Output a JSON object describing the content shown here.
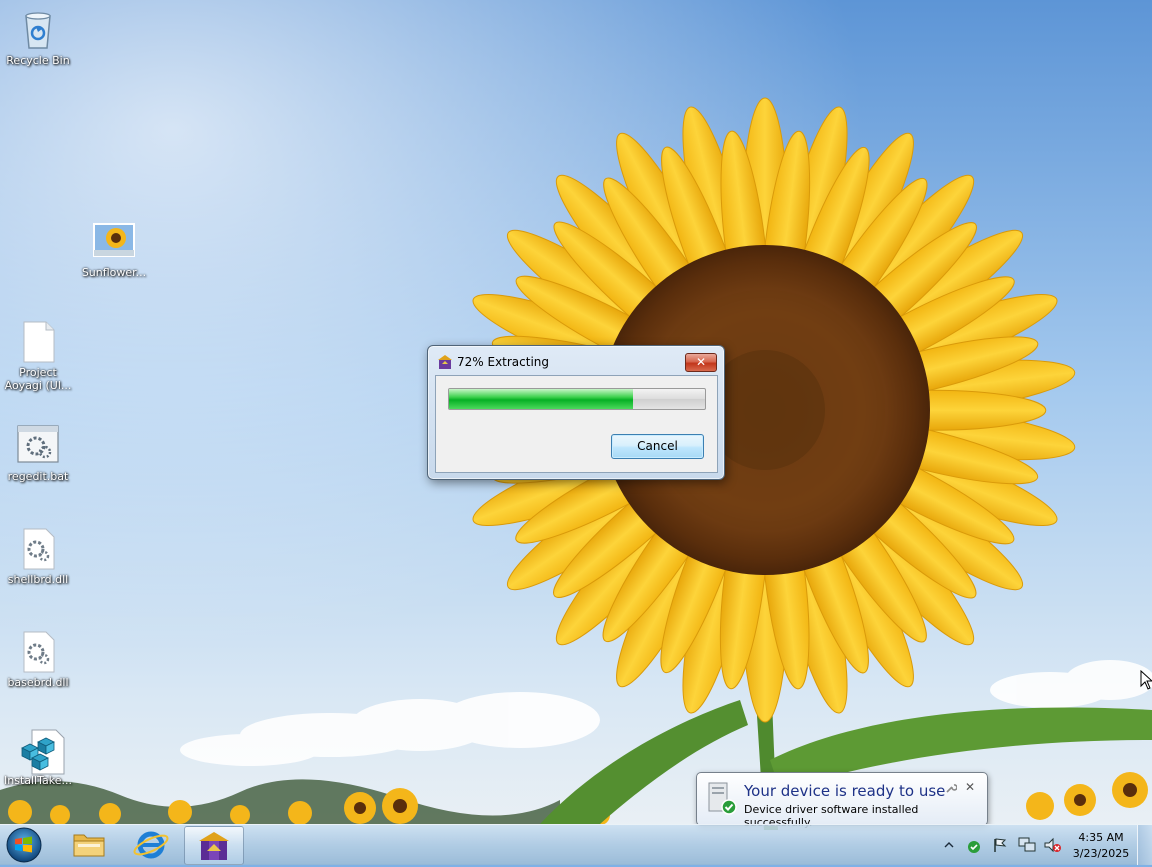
{
  "desktop": {
    "icons": [
      {
        "name": "recycle-bin",
        "label": "Recycle Bin"
      },
      {
        "name": "sunflower",
        "label": "Sunflower..."
      },
      {
        "name": "project-aoyagi",
        "label": "Project\nAoyagi (Ul..."
      },
      {
        "name": "regedit-bat",
        "label": "regedit.bat"
      },
      {
        "name": "shellbrd-dll",
        "label": "shellbrd.dll"
      },
      {
        "name": "basebrd-dll",
        "label": "basebrd.dll"
      },
      {
        "name": "install-take",
        "label": "InstallTake..."
      }
    ]
  },
  "dialog": {
    "title": "72% Extracting",
    "progress": 0.72,
    "cancel_label": "Cancel",
    "close_glyph": "✕"
  },
  "balloon": {
    "title": "Your device is ready to use",
    "text": "Device driver software installed successfully.",
    "close_glyph": "✕"
  },
  "taskbar": {
    "pinned": [
      {
        "name": "windows-explorer",
        "active": false
      },
      {
        "name": "internet-explorer",
        "active": false
      },
      {
        "name": "extractor-app",
        "active": true
      }
    ],
    "clock": {
      "time": "4:35 AM",
      "date": "3/23/2025"
    }
  },
  "colors": {
    "progress_fill": "#06b025",
    "balloon_title": "#1e3287",
    "close_button": "#c2361b"
  }
}
